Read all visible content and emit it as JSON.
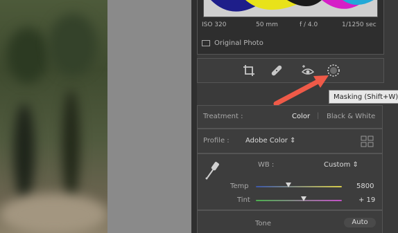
{
  "exif": {
    "iso": "ISO 320",
    "focal": "50 mm",
    "aperture": "f / 4.0",
    "shutter": "1/1250 sec"
  },
  "original_photo_label": "Original Photo",
  "tools": [
    "crop-icon",
    "heal-icon",
    "redeye-icon",
    "masking-icon"
  ],
  "tooltip": "Masking (Shift+W)",
  "treatment": {
    "label": "Treatment :",
    "color": "Color",
    "bw": "Black & White"
  },
  "profile": {
    "label": "Profile :",
    "value": "Adobe Color ⇕"
  },
  "wb": {
    "label": "WB :",
    "value": "Custom ⇕"
  },
  "temp": {
    "label": "Temp",
    "value": "5800",
    "position_fraction": 0.38
  },
  "tint": {
    "label": "Tint",
    "value": "+ 19",
    "position_fraction": 0.56
  },
  "tone": {
    "label": "Tone",
    "auto": "Auto"
  },
  "colors": {
    "accent_arrow": "#ef5a48"
  }
}
